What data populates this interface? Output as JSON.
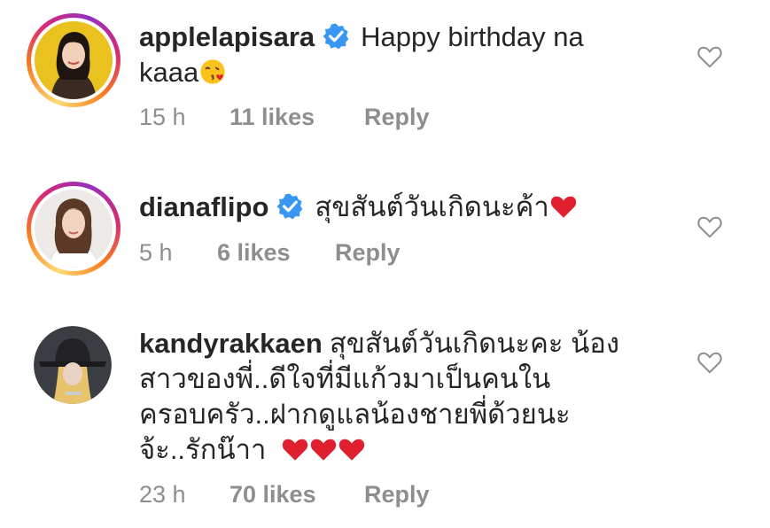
{
  "comments": [
    {
      "username": "applelapisara",
      "verified": true,
      "text": "Happy birthday na kaaa",
      "emoji": "kissing-heart-emoji",
      "time": "15 h",
      "likes": "11 likes",
      "reply": "Reply"
    },
    {
      "username": "dianaflipo",
      "verified": true,
      "text": "สุขสันต์วันเกิดนะค้า",
      "emoji": "red-heart-emoji",
      "time": "5 h",
      "likes": "6 likes",
      "reply": "Reply"
    },
    {
      "username": "kandyrakkaen",
      "verified": false,
      "text": "สุขสันต์วันเกิดนะคะ น้องสาวของพี่..ดีใจที่มีแก้วมาเป็นคนในครอบครัว..ฝากดูแลน้องชายพี่ด้วยนะจ้ะ..รักน๊าา",
      "emoji": "red-heart-emoji x3",
      "time": "23 h",
      "likes": "70 likes",
      "reply": "Reply"
    }
  ],
  "colors": {
    "text": "#262626",
    "meta": "#8e8e8e",
    "verified": "#3897f0",
    "heart": "#e0202e"
  }
}
